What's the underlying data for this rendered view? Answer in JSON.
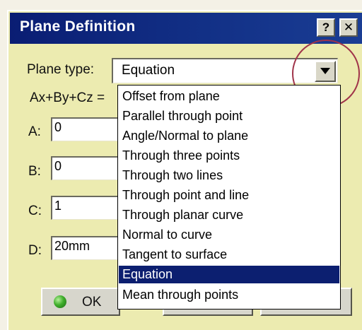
{
  "window": {
    "title": "Plane Definition",
    "help_label": "?",
    "close_label": "✕"
  },
  "plane_type": {
    "label": "Plane type:",
    "value": "Equation"
  },
  "equation_label": "Ax+By+Cz =",
  "fields": [
    {
      "label": "A:",
      "value": "0"
    },
    {
      "label": "B:",
      "value": "0"
    },
    {
      "label": "C:",
      "value": "1"
    },
    {
      "label": "D:",
      "value": "20mm"
    }
  ],
  "dropdown": {
    "options": [
      "Offset from plane",
      "Parallel through point",
      "Angle/Normal to plane",
      "Through three points",
      "Through two lines",
      "Through point and line",
      "Through planar curve",
      "Normal to curve",
      "Tangent to surface",
      "Equation",
      "Mean through points"
    ],
    "selected": "Equation"
  },
  "buttons": {
    "ok_label": "OK"
  },
  "colors": {
    "titlebar": "#0a1d73",
    "dialog": "#ecebb0",
    "highlight": "#0c1f70",
    "annotation_circle": "#a0344a"
  }
}
